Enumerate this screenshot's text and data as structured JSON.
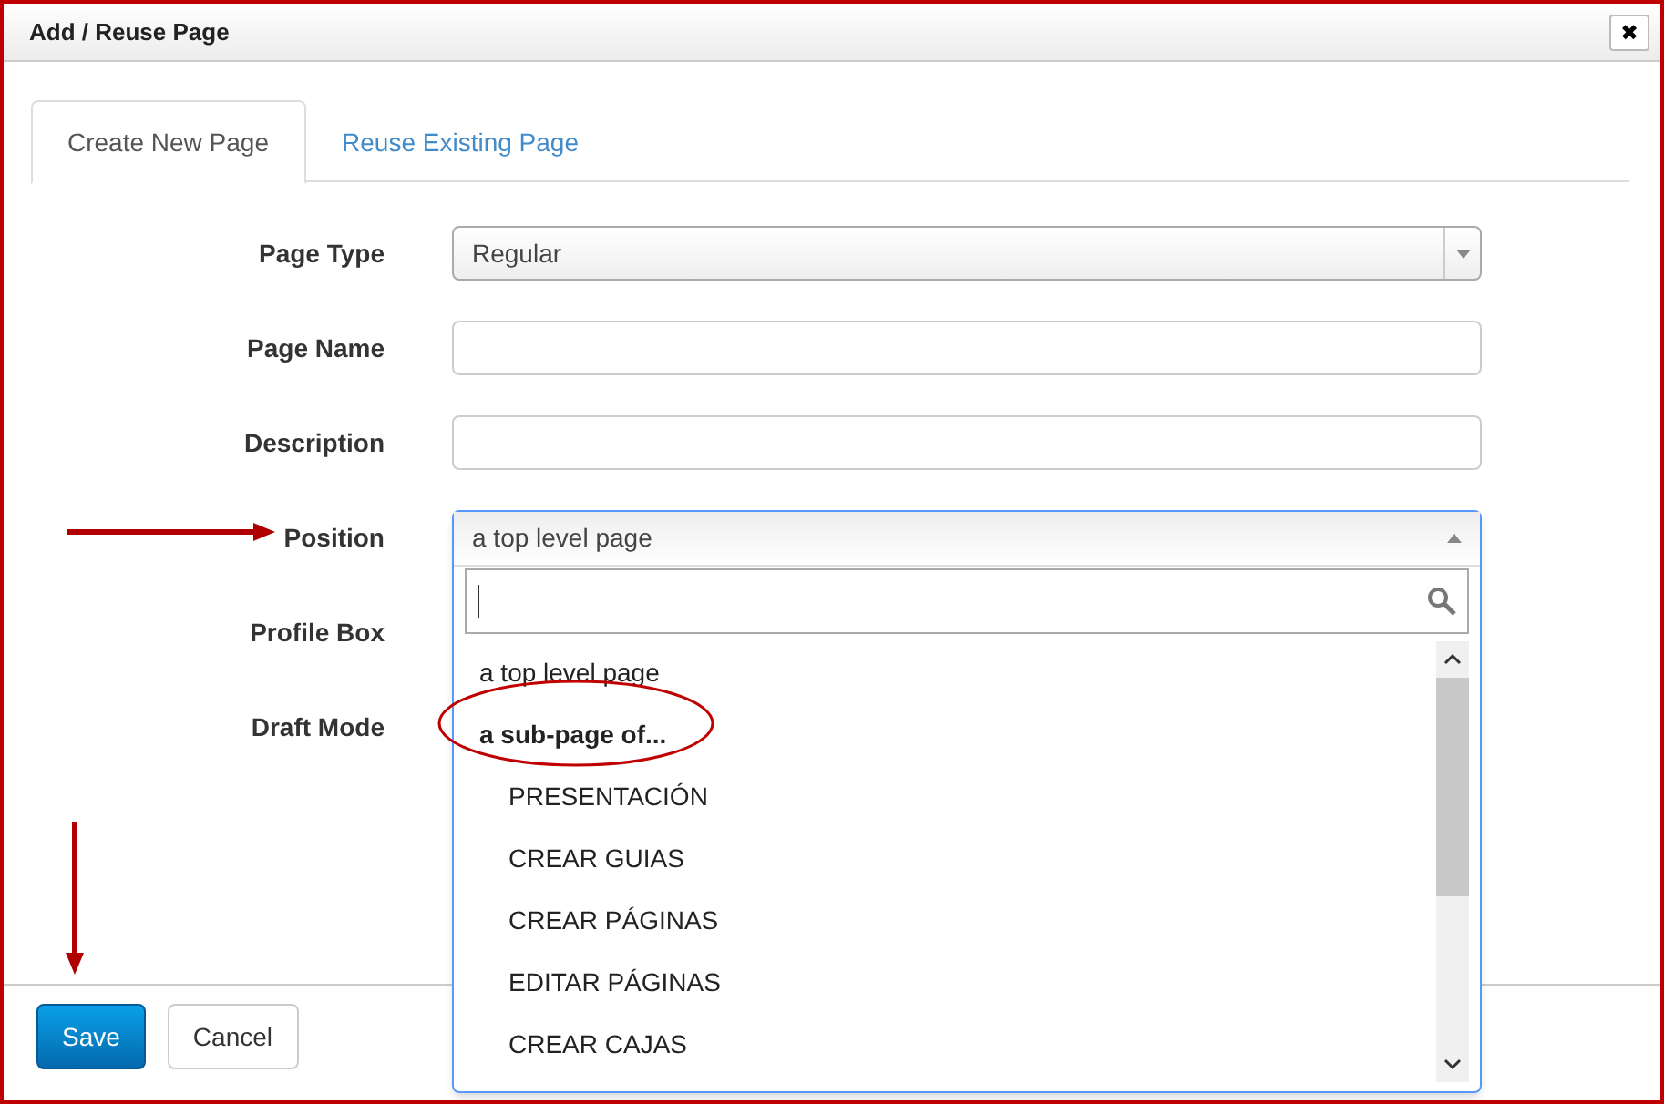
{
  "dialog": {
    "title": "Add / Reuse Page",
    "close": "✖"
  },
  "tabs": [
    {
      "label": "Create New Page",
      "selected": true
    },
    {
      "label": "Reuse Existing Page",
      "selected": false
    }
  ],
  "fields": [
    {
      "label": "Page Type",
      "kind": "select",
      "value": "Regular"
    },
    {
      "label": "Page Name",
      "kind": "text"
    },
    {
      "label": "Description",
      "kind": "text"
    },
    {
      "label": "Position",
      "kind": "open-select",
      "value": "a top level page",
      "options": [
        {
          "label": "a top level page",
          "kind": "option"
        },
        {
          "label": "a sub-page of...",
          "kind": "group",
          "children": [
            {
              "label": "PRESENTACIÓN"
            },
            {
              "label": "CREAR GUIAS"
            },
            {
              "label": "CREAR PÁGINAS"
            },
            {
              "label": "EDITAR PÁGINAS"
            },
            {
              "label": "CREAR CAJAS"
            }
          ]
        }
      ]
    },
    {
      "label": "Profile Box",
      "kind": "covered"
    },
    {
      "label": "Draft Mode",
      "kind": "covered"
    }
  ],
  "buttons": [
    {
      "label": "Save",
      "kind": "primary"
    },
    {
      "label": "Cancel",
      "kind": "default"
    }
  ]
}
